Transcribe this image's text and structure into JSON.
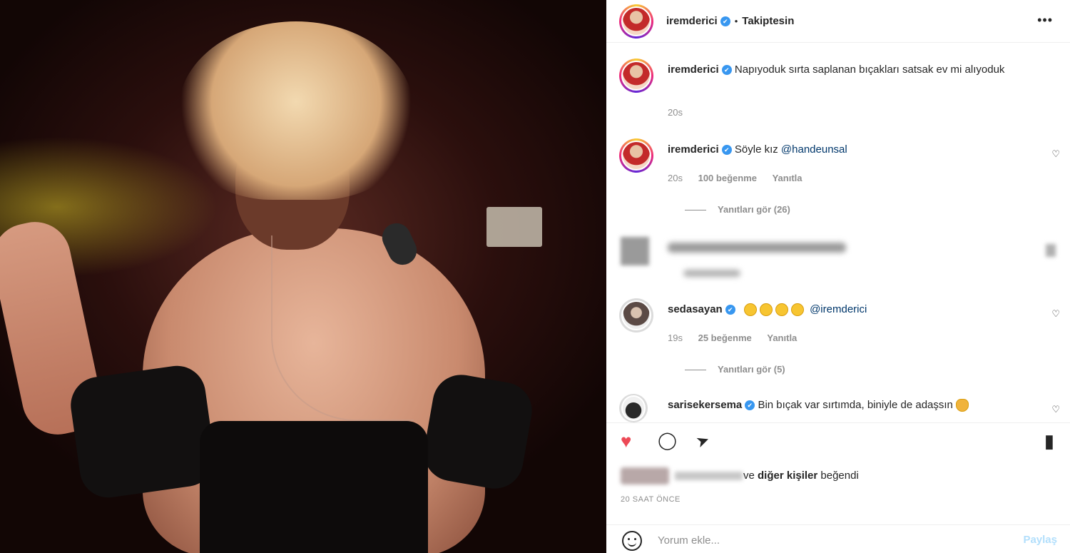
{
  "post": {
    "header": {
      "username": "iremderici",
      "separator": "•",
      "follow_status": "Takiptesin",
      "more_label": "•••"
    },
    "caption": {
      "username": "iremderici",
      "text": "Napıyoduk sırta saplanan bıçakları satsak ev mi alıyoduk",
      "time": "20s"
    },
    "comments": [
      {
        "username": "iremderici",
        "text": "Söyle kız ",
        "mention": "@handeunsal",
        "time": "20s",
        "likes": "100 beğenme",
        "reply": "Yanıtla",
        "view_replies": "Yanıtları gör (26)"
      },
      {
        "username": "sedasayan",
        "mention": "@iremderici",
        "time": "19s",
        "likes": "25 beğenme",
        "reply": "Yanıtla",
        "view_replies": "Yanıtları gör (5)"
      },
      {
        "username": "sarisekersema",
        "text": "Bin bıçak var sırtımda, biniyle de adaşsın"
      }
    ],
    "likes_text_normal": "ve ",
    "likes_text_bold": "diğer kişiler",
    "likes_text_end": " beğendi",
    "timestamp": "20 SAAT ÖNCE",
    "add_comment_placeholder": "Yorum ekle...",
    "share_label": "Paylaş"
  },
  "icons": {
    "verified": "✔",
    "heart_outline": "♡",
    "like_filled": "♥",
    "comment": "◯",
    "send": "➤",
    "bookmark": "▮"
  },
  "colors": {
    "accent_blue": "#3897f0",
    "like_red": "#ed4956",
    "mention": "#00376b",
    "muted": "#8e8e8e"
  }
}
